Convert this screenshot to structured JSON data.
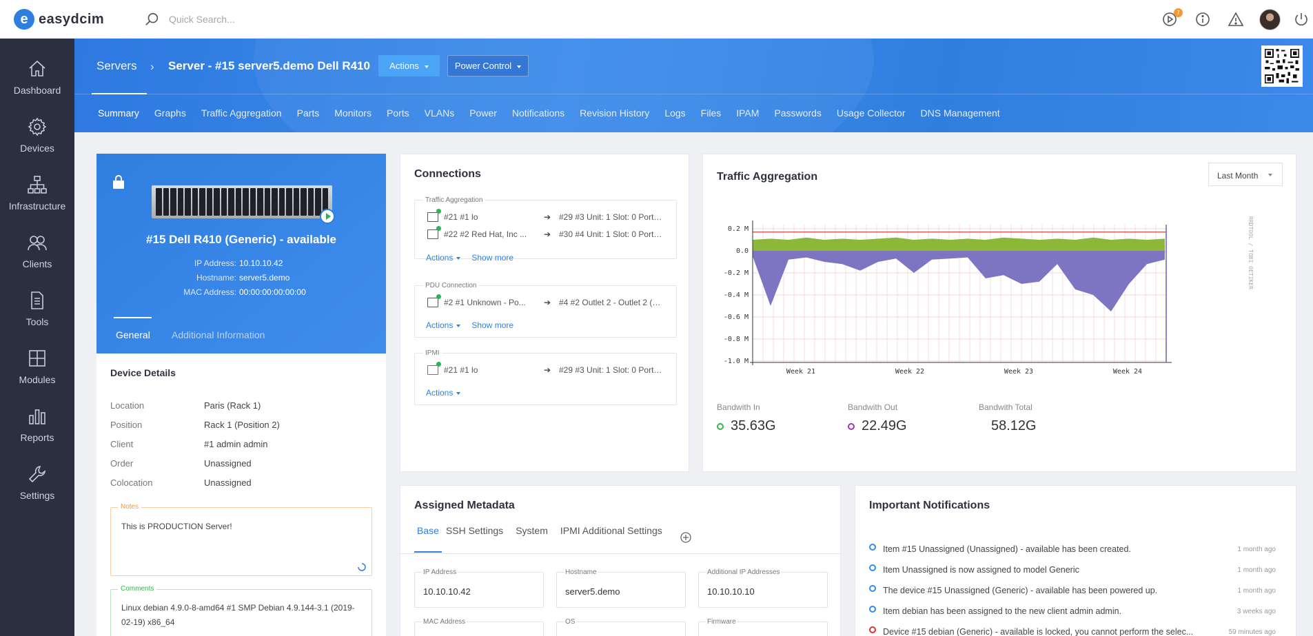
{
  "brand": {
    "name": "easydcim"
  },
  "search": {
    "placeholder": "Quick Search..."
  },
  "topbar": {
    "badge_count": "7"
  },
  "sidebar": {
    "items": [
      {
        "label": "Dashboard",
        "icon": "home-icon"
      },
      {
        "label": "Devices",
        "icon": "gear-icon"
      },
      {
        "label": "Infrastructure",
        "icon": "sitemap-icon"
      },
      {
        "label": "Clients",
        "icon": "users-icon"
      },
      {
        "label": "Tools",
        "icon": "document-icon"
      },
      {
        "label": "Modules",
        "icon": "grid-icon"
      },
      {
        "label": "Reports",
        "icon": "bar-chart-icon"
      },
      {
        "label": "Settings",
        "icon": "wrench-icon"
      }
    ]
  },
  "header": {
    "breadcrumb": "Servers",
    "title": "Server - #15 server5.demo Dell R410",
    "actions_label": "Actions",
    "power_label": "Power Control",
    "tabs": [
      "Summary",
      "Graphs",
      "Traffic Aggregation",
      "Parts",
      "Monitors",
      "Ports",
      "VLANs",
      "Power",
      "Notifications",
      "Revision History",
      "Logs",
      "Files",
      "IPAM",
      "Passwords",
      "Usage Collector",
      "DNS Management"
    ]
  },
  "device": {
    "name": "#15 Dell R410 (Generic) - available",
    "ip_label": "IP Address:",
    "ip": "10.10.10.42",
    "hostname_label": "Hostname:",
    "hostname": "server5.demo",
    "mac_label": "MAC Address:",
    "mac": "00:00:00:00:00:00",
    "tab_general": "General",
    "tab_additional": "Additional Information",
    "details_title": "Device Details",
    "details": [
      {
        "k": "Location",
        "v": "Paris (Rack 1)"
      },
      {
        "k": "Position",
        "v": "Rack 1 (Position 2)"
      },
      {
        "k": "Client",
        "v": "#1 admin admin"
      },
      {
        "k": "Order",
        "v": "Unassigned"
      },
      {
        "k": "Colocation",
        "v": "Unassigned"
      }
    ],
    "notes_label": "Notes",
    "notes_text": "This is PRODUCTION Server!",
    "comments_label": "Comments",
    "comments_text": "Linux debian 4.9.0-8-amd64 #1 SMP Debian 4.9.144-3.1 (2019-02-19) x86_64"
  },
  "connections": {
    "title": "Connections",
    "actions_label": "Actions",
    "show_more_label": "Show more",
    "groups": [
      {
        "label": "Traffic Aggregation",
        "rows": [
          {
            "a": "#21 #1 lo",
            "b": "#29 #3 Unit: 1 Slot: 0 Port:..."
          },
          {
            "a": "#22 #2 Red Hat, Inc ...",
            "b": "#30 #4 Unit: 1 Slot: 0 Port:..."
          }
        ]
      },
      {
        "label": "PDU Connection",
        "rows": [
          {
            "a": "#2 #1 Unknown - Po...",
            "b": "#4 #2 Outlet 2 - Outlet 2 (o..."
          }
        ]
      },
      {
        "label": "IPMI",
        "rows": [
          {
            "a": "#21 #1 lo",
            "b": "#29 #3 Unit: 1 Slot: 0 Port:..."
          }
        ]
      }
    ]
  },
  "traffic": {
    "title": "Traffic Aggregation",
    "range": "Last Month",
    "bandwidth_in_label": "Bandwith In",
    "bandwidth_in": "35.63G",
    "bandwidth_out_label": "Bandwith Out",
    "bandwidth_out": "22.49G",
    "bandwidth_total_label": "Bandwith Total",
    "bandwidth_total": "58.12G",
    "rrd_label": "RRDTOOL / TOBI OETIKER",
    "colors": {
      "in_dot": "#37b24d",
      "out_dot": "#9c36b5",
      "in_area": "#8cb83a",
      "out_area": "#7d74c2",
      "limit": "#c92a2a"
    }
  },
  "chart_data": {
    "type": "area",
    "title": "",
    "xlabel": "",
    "ylabel": "",
    "ylim": [
      -1.0,
      0.2
    ],
    "y_ticks": [
      "0.2 M",
      "0.0",
      "-0.2 M",
      "-0.4 M",
      "-0.6 M",
      "-0.8 M",
      "-1.0 M"
    ],
    "x_ticks": [
      "Week 21",
      "Week 22",
      "Week 23",
      "Week 24"
    ],
    "limit_line": 0.17,
    "series": [
      {
        "values": [
          0.1,
          0.11,
          0.1,
          0.12,
          0.1,
          0.11,
          0.1,
          0.11,
          0.12,
          0.1,
          0.11,
          0.1,
          0.11,
          0.1,
          0.12,
          0.11,
          0.1,
          0.11,
          0.1,
          0.12,
          0.1,
          0.11,
          0.1,
          0.11
        ]
      },
      {
        "values": [
          -0.05,
          -0.5,
          -0.08,
          -0.06,
          -0.1,
          -0.12,
          -0.18,
          -0.1,
          -0.07,
          -0.2,
          -0.08,
          -0.07,
          -0.06,
          -0.25,
          -0.22,
          -0.3,
          -0.28,
          -0.12,
          -0.35,
          -0.4,
          -0.55,
          -0.3,
          -0.12,
          -0.08
        ]
      }
    ]
  },
  "metadata": {
    "title": "Assigned Metadata",
    "tabs": [
      "Base",
      "SSH Settings",
      "System",
      "IPMI Additional Settings"
    ],
    "fields": [
      {
        "label": "IP Address",
        "value": "10.10.10.42"
      },
      {
        "label": "Hostname",
        "value": "server5.demo"
      },
      {
        "label": "Additional IP Addresses",
        "value": "10.10.10.10"
      },
      {
        "label": "MAC Address",
        "value": ""
      },
      {
        "label": "OS",
        "value": ""
      },
      {
        "label": "Firmware",
        "value": ""
      }
    ]
  },
  "notifications": {
    "title": "Important Notifications",
    "items": [
      {
        "text": "Item #15 Unassigned (Unassigned) - available has been created.",
        "time": "1 month ago",
        "color": "#2f8cf0"
      },
      {
        "text": "Item Unassigned is now assigned to model Generic",
        "time": "1 month ago",
        "color": "#2f8cf0"
      },
      {
        "text": "The device #15 Unassigned (Generic) - available has been powered up.",
        "time": "1 month ago",
        "color": "#2f8cf0"
      },
      {
        "text": "Item debian has been assigned to the new client admin admin.",
        "time": "3 weeks ago",
        "color": "#2f8cf0"
      },
      {
        "text": "Device #15 debian (Generic) - available is locked, you cannot perform the selec...",
        "time": "59 minutes ago",
        "color": "#e03131"
      }
    ]
  }
}
